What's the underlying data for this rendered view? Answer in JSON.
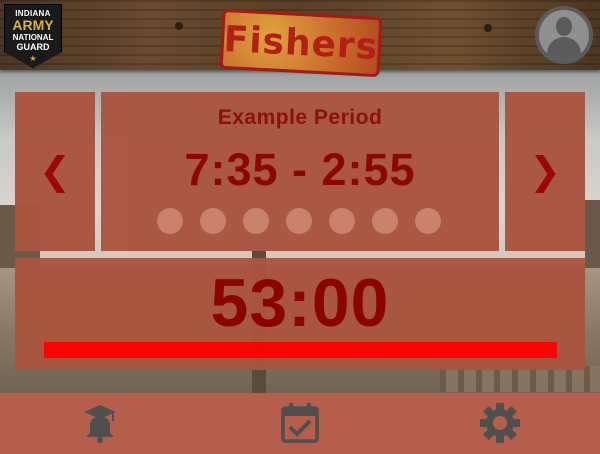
{
  "header": {
    "badge": {
      "line1": "INDIANA",
      "line2": "ARMY",
      "line3": "NATIONAL",
      "line4": "GUARD",
      "star": "★"
    },
    "logo_text": "Fishers",
    "avatar_icon": "user-avatar-icon"
  },
  "period": {
    "prev_label": "❮",
    "next_label": "❯",
    "name": "Example Period",
    "time_range": "7:35 - 2:55",
    "dot_count": 7
  },
  "countdown": {
    "time": "53:00",
    "progress_fraction": 1.0
  },
  "footer": {
    "icons": [
      "school-bell-icon",
      "calendar-check-icon",
      "gear-icon"
    ]
  },
  "colors": {
    "card": "#a9553f",
    "accent_text": "#8b0000",
    "progress": "#ff0000",
    "footer": "#b45e4b"
  }
}
